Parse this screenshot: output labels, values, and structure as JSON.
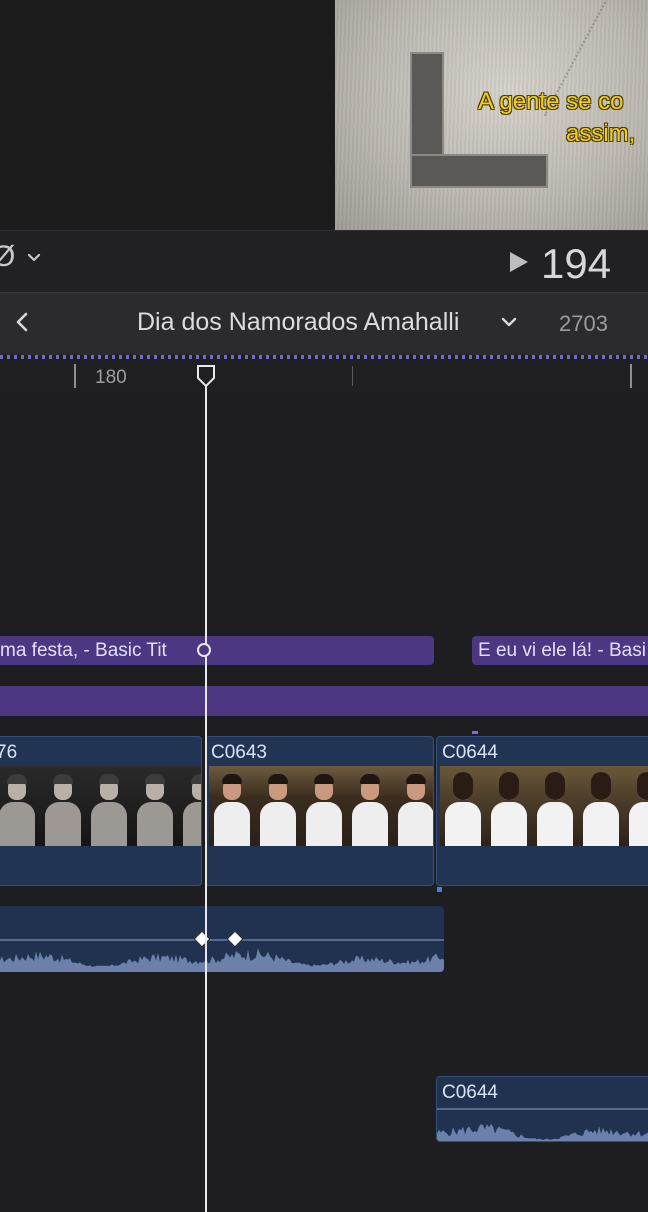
{
  "viewer": {
    "subtitle_line1": "A gente se co",
    "subtitle_line2": "assim,"
  },
  "control_bar": {
    "tool_icon": "speed-retime-icon",
    "timecode": "194"
  },
  "project": {
    "title": "Dia dos Namorados Amahalli",
    "duration": "2703"
  },
  "ruler": {
    "label": "180"
  },
  "timeline": {
    "title_clips": [
      {
        "label": "ma festa,  - Basic Tit"
      },
      {
        "label": "E eu vi ele lá! - Basi"
      }
    ],
    "video_clips": [
      {
        "name": "76",
        "thumb_style": "dark"
      },
      {
        "name": "C0643",
        "thumb_style": "warm"
      },
      {
        "name": "C0644",
        "thumb_style": "girl"
      }
    ],
    "audio_clips": [
      {
        "name": "C0644"
      }
    ]
  },
  "colors": {
    "title_clip": "#4b3782",
    "video_clip": "#223453",
    "audio_wave": "#6b80ab",
    "timecode_text": "#d7d7db"
  }
}
